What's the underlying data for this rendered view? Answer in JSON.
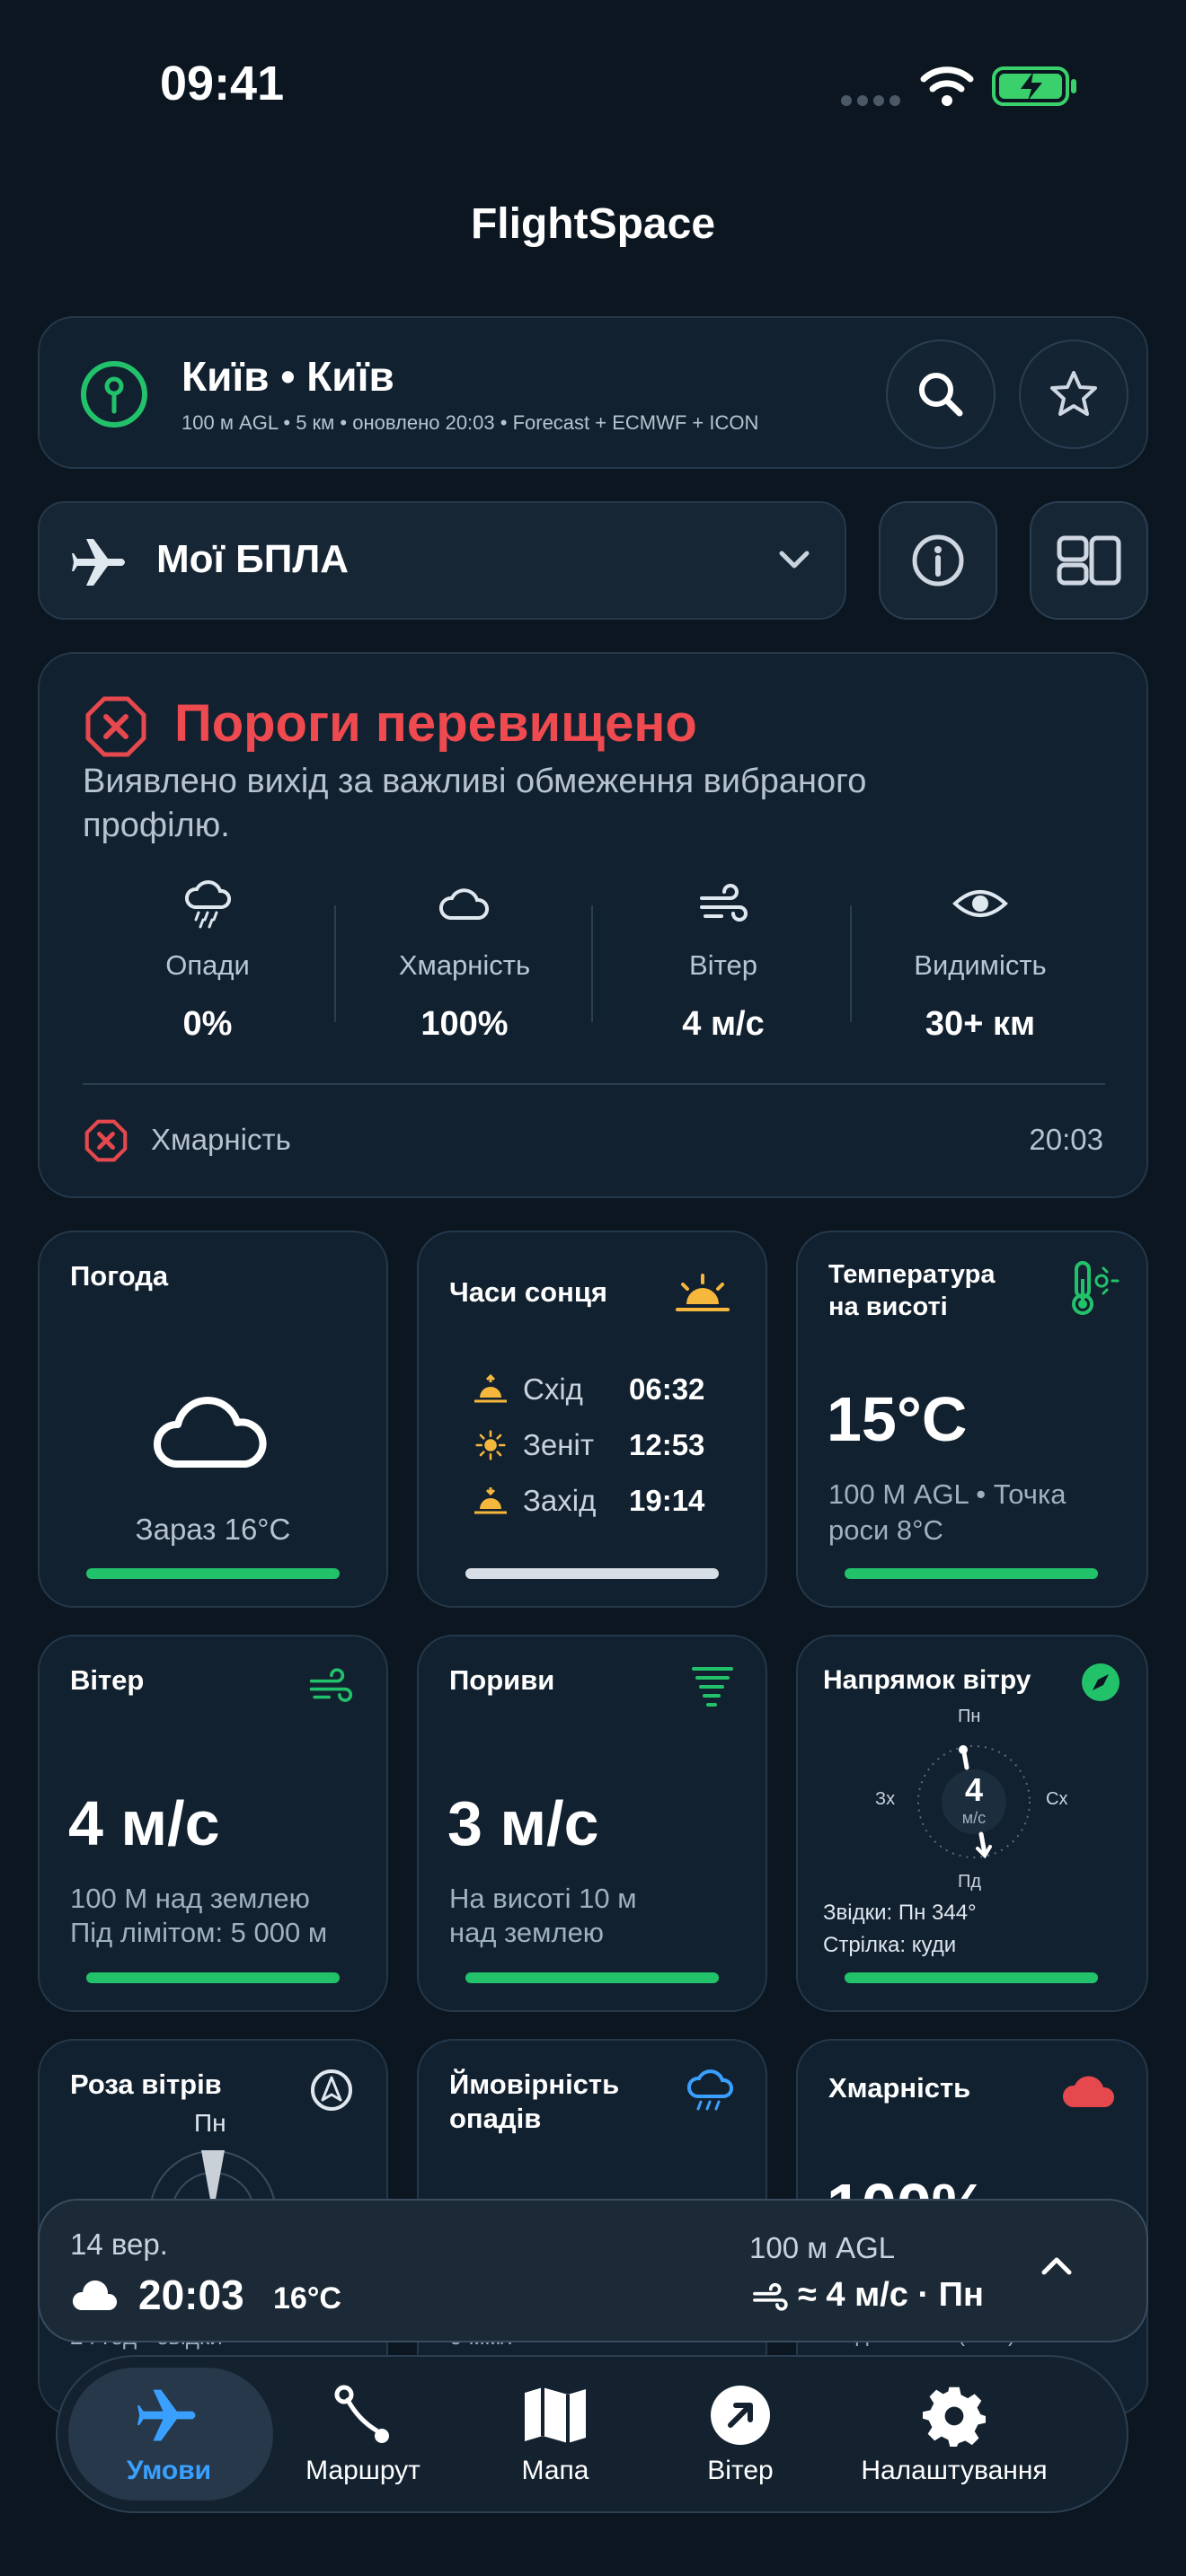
{
  "status_bar": {
    "time": "09:41"
  },
  "app": {
    "title": "FlightSpace"
  },
  "location": {
    "name": "Київ • Київ",
    "details": "100 м AGL • 5 км • оновлено 20:03 • Forecast + ECMWF + ICON"
  },
  "profile": {
    "selected": "Мої БПЛА"
  },
  "alert": {
    "title": "Пороги перевищено",
    "message": "Виявлено вихід за важливі обмеження вибраного профілю.",
    "metrics": [
      {
        "label": "Опади",
        "value": "0%"
      },
      {
        "label": "Хмарність",
        "value": "100%"
      },
      {
        "label": "Вітер",
        "value": "4 м/с"
      },
      {
        "label": "Видимість",
        "value": "30+ км"
      }
    ],
    "exceeded": {
      "label": "Хмарність",
      "time": "20:03"
    }
  },
  "tiles": {
    "weather": {
      "title": "Погода",
      "now": "Зараз 16°C"
    },
    "sun": {
      "title": "Часи сонця",
      "rows": [
        {
          "name": "Схід",
          "time": "06:32"
        },
        {
          "name": "Зеніт",
          "time": "12:53"
        },
        {
          "name": "Захід",
          "time": "19:14"
        }
      ]
    },
    "temp_alt": {
      "title_1": "Температура",
      "title_2": "на висоті",
      "value": "15°C",
      "sub_1": "100 М AGL • Точка",
      "sub_2": "роси 8°C"
    },
    "wind": {
      "title": "Вітер",
      "value": "4 м/с",
      "sub_1": "100 М над землею",
      "sub_2": "Під лімітом: 5 000 м"
    },
    "gusts": {
      "title": "Пориви",
      "value": "3 м/с",
      "sub_1": "На висоті 10 м",
      "sub_2": "над землею"
    },
    "wind_dir": {
      "title": "Напрямок вітру",
      "n": "Пн",
      "e": "Сх",
      "s": "Пд",
      "w": "Зх",
      "speed": "4",
      "unit": "м/с",
      "from": "Звідки: Пн 344°",
      "arrow": "Стрілка: куди"
    },
    "wind_rose": {
      "title": "Роза вітрів",
      "n": "Пн",
      "footer": "24 год · звідки"
    },
    "precip": {
      "title_1": "Ймовірність",
      "title_2": "опадів",
      "footer": "0 мм/г"
    },
    "clouds": {
      "title": "Хмарність",
      "value": "100%",
      "footer": "Над землею (AGL)"
    }
  },
  "forecast_sheet": {
    "date": "14 вер.",
    "time": "20:03",
    "temp": "16°C",
    "alt": "100 м AGL",
    "wind": "≈ 4 м/с · Пн"
  },
  "tabbar": {
    "items": [
      {
        "label": "Умови"
      },
      {
        "label": "Маршрут"
      },
      {
        "label": "Мапа"
      },
      {
        "label": "Вітер"
      },
      {
        "label": "Налаштування"
      }
    ]
  },
  "colors": {
    "accent": "#3aa0ff",
    "ok": "#22c26b",
    "danger": "#e5484d",
    "sun": "#f5b83d"
  }
}
